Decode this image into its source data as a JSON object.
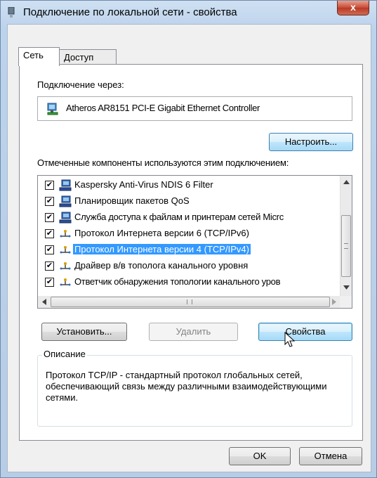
{
  "window": {
    "title": "Подключение по локальной сети - свойства",
    "close_label": "x"
  },
  "tabs": [
    {
      "label": "Сеть",
      "active": true
    },
    {
      "label": "Доступ",
      "active": false
    }
  ],
  "connect_via": {
    "label": "Подключение через:",
    "adapter_name": "Atheros AR8151 PCI-E Gigabit Ethernet Controller",
    "configure_button": "Настроить..."
  },
  "components": {
    "label": "Отмеченные компоненты используются этим подключением:",
    "items": [
      {
        "label": "Kaspersky Anti-Virus NDIS 6 Filter",
        "checked": true,
        "icon": "network-client-icon",
        "selected": false
      },
      {
        "label": "Планировщик пакетов QoS",
        "checked": true,
        "icon": "network-client-icon",
        "selected": false
      },
      {
        "label": "Служба доступа к файлам и принтерам сетей Micrс",
        "checked": true,
        "icon": "network-client-icon",
        "selected": false
      },
      {
        "label": "Протокол Интернета версии 6 (TCP/IPv6)",
        "checked": true,
        "icon": "protocol-icon",
        "selected": false
      },
      {
        "label": "Протокол Интернета версии 4 (TCP/IPv4)",
        "checked": true,
        "icon": "protocol-icon",
        "selected": true
      },
      {
        "label": "Драйвер в/в тополога канального уровня",
        "checked": true,
        "icon": "protocol-icon",
        "selected": false
      },
      {
        "label": "Ответчик обнаружения топологии канального уров",
        "checked": true,
        "icon": "protocol-icon",
        "selected": false
      }
    ]
  },
  "actions": {
    "install": "Установить...",
    "remove": "Удалить",
    "properties": "Свойства"
  },
  "description": {
    "legend": "Описание",
    "text": "Протокол TCP/IP - стандартный протокол глобальных сетей, обеспечивающий связь между различными взаимодействующими сетями."
  },
  "footer": {
    "ok": "OK",
    "cancel": "Отмена"
  },
  "colors": {
    "selection": "#3399ff",
    "close_button": "#c84a36"
  }
}
